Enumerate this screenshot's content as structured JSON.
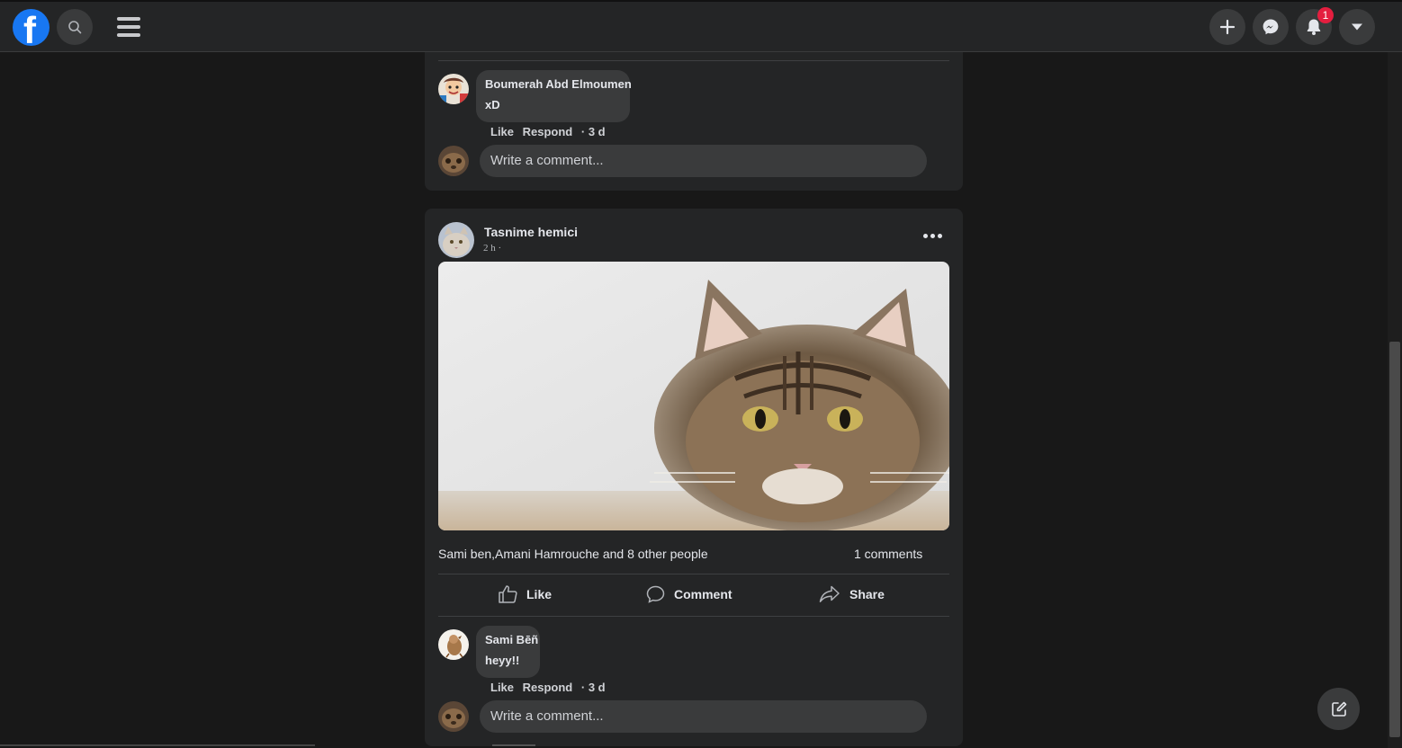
{
  "topbar": {
    "logo_letter": "f",
    "notification_count": "1"
  },
  "icons": {
    "logo": "facebook-logo-icon",
    "search": "search-icon",
    "menu": "hamburger-menu-icon",
    "create": "plus-icon",
    "messenger": "messenger-icon",
    "notifications": "bell-icon",
    "account": "caret-down-icon",
    "compose": "compose-icon"
  },
  "colors": {
    "brand": "#1877f2",
    "badge": "#e41e3f",
    "background": "#181818",
    "card": "#242526"
  },
  "post1": {
    "comment": {
      "author": "Boumerah Abd Elmoumen",
      "text": "xD",
      "like_label": "Like",
      "respond_label": "Respond",
      "time": "· 3 d"
    },
    "write_placeholder": "Write a comment..."
  },
  "post2": {
    "author": "Tasnime hemici",
    "time": "2 h ·",
    "likes_summary": "Sami ben,Amani Hamrouche and 8 other people",
    "comments_count": "1 comments",
    "actions": {
      "like": "Like",
      "comment": "Comment",
      "share": "Share"
    },
    "comment": {
      "author": "Sami Bēñ",
      "text": "heyy!!",
      "like_label": "Like",
      "respond_label": "Respond",
      "time": "· 3 d"
    },
    "write_placeholder": "Write a comment..."
  }
}
